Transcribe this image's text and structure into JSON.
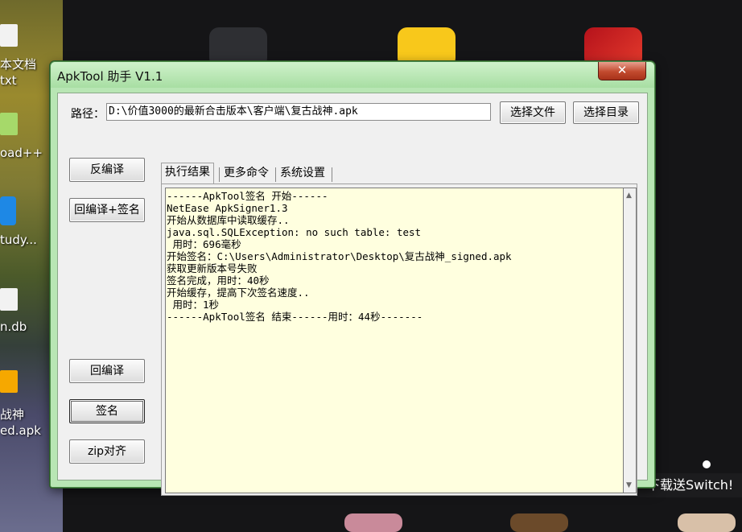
{
  "desktop": {
    "icons": [
      {
        "label1": "本文档",
        "label2": "txt"
      },
      {
        "label1": "oad++"
      },
      {
        "label1": "tudy..."
      },
      {
        "label1": "n.db"
      },
      {
        "label1": "战神",
        "label2": "ed.apk"
      }
    ],
    "promo_text": "下载送Switch!"
  },
  "window": {
    "title": "ApkTool 助手 V1.1",
    "close_symbol": "✕",
    "path_label": "路径：",
    "path_value": "D:\\价值3000的最新合击版本\\客户端\\复古战神.apk",
    "select_file_button": "选择文件",
    "select_dir_button": "选择目录",
    "side_buttons": {
      "decompile": "反编译",
      "recompile_sign": "回编译+签名",
      "recompile": "回编译",
      "sign": "签名",
      "zipalign": "zip对齐"
    },
    "tabs": [
      "执行结果",
      "更多命令",
      "系统设置"
    ],
    "output_lines": [
      "------ApkTool签名 开始------",
      "NetEase ApkSigner1.3",
      "开始从数据库中读取缓存..",
      "java.sql.SQLException: no such table: test",
      " 用时：696毫秒",
      "开始签名：C:\\Users\\Administrator\\Desktop\\复古战神_signed.apk",
      "获取更新版本号失败",
      "签名完成，用时：40秒",
      "开始缓存，提高下次签名速度..",
      " 用时：1秒",
      "------ApkTool签名 结束------用时：44秒-------"
    ]
  },
  "colors": {
    "window_frame": "#b8e6b4",
    "output_background": "#ffffdf",
    "close_button": "#c24a2e"
  }
}
